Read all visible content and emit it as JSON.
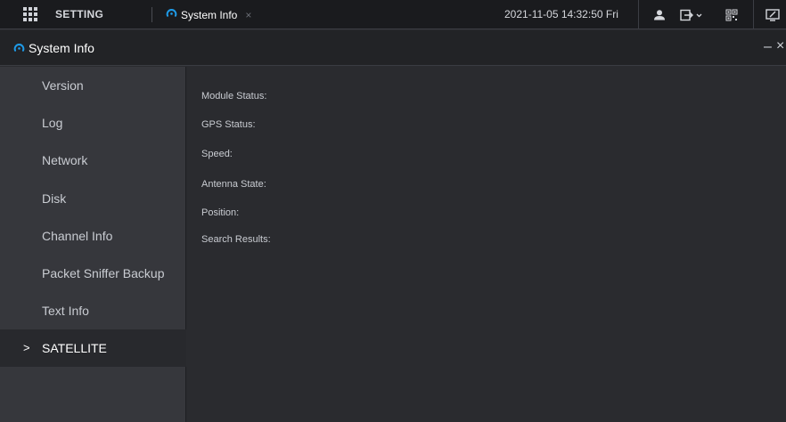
{
  "topbar": {
    "setting_label": "SETTING",
    "active_tab_label": "System Info",
    "active_tab_close": "×",
    "datetime": "2021-11-05 14:32:50 Fri",
    "icons": [
      "apps-grid-icon",
      "user-icon",
      "logout-icon",
      "qr-code-icon",
      "monitor-icon"
    ]
  },
  "panel": {
    "title": "System Info",
    "minimize": "–",
    "close": "×"
  },
  "sidebar": {
    "items": [
      {
        "label": "Version",
        "active": false
      },
      {
        "label": "Log",
        "active": false
      },
      {
        "label": "Network",
        "active": false
      },
      {
        "label": "Disk",
        "active": false
      },
      {
        "label": "Channel Info",
        "active": false
      },
      {
        "label": "Packet Sniffer Backup",
        "active": false
      },
      {
        "label": "Text Info",
        "active": false
      },
      {
        "label": "SATELLITE",
        "active": true,
        "marker": ">"
      }
    ]
  },
  "content": {
    "fields": [
      {
        "label": "Module Status:"
      },
      {
        "label": "GPS Status:"
      },
      {
        "label": "Speed:"
      },
      {
        "label": "Antenna State:"
      },
      {
        "label": "Position:"
      },
      {
        "label": "Search Results:"
      }
    ]
  },
  "colors": {
    "accent": "#1e9be8",
    "background": "#2a2b2f",
    "sidebar": "#36373c",
    "topbar": "#1a1b1e"
  }
}
